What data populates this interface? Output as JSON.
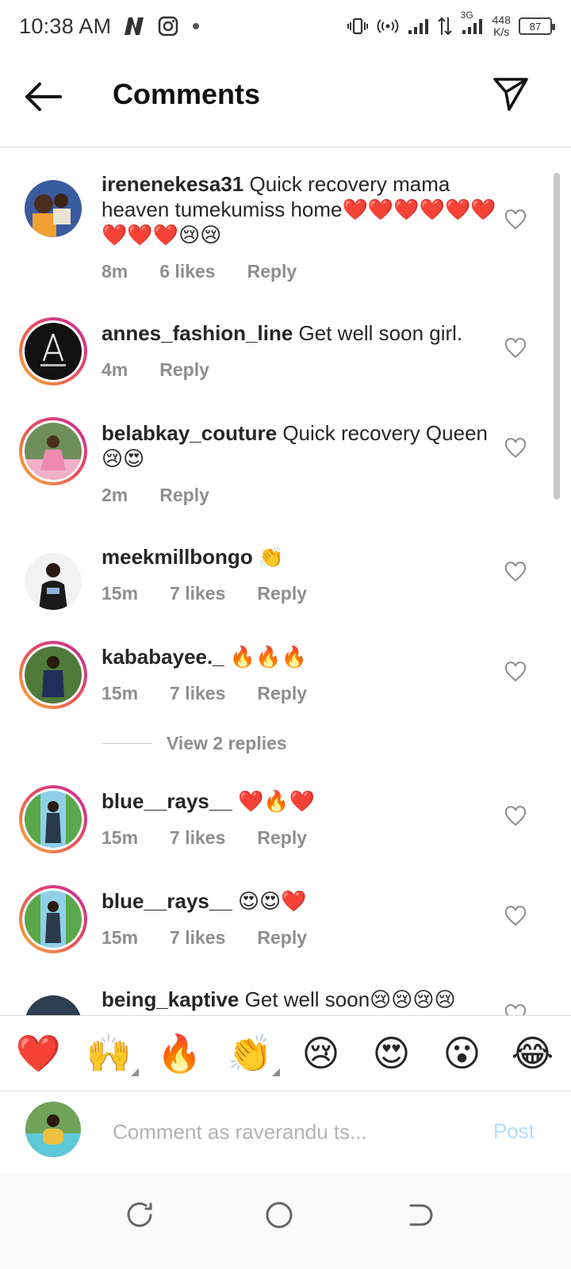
{
  "status_bar": {
    "time": "10:38 AM",
    "net_type": "3G",
    "net_speed_value": "448",
    "net_speed_unit": "K/s",
    "battery": "87",
    "icons": [
      "netflix-n-icon",
      "instagram-icon",
      "dot-icon",
      "vibrate-icon",
      "hotspot-icon",
      "signal-icon",
      "data-arrows-icon",
      "signal-3g-icon",
      "battery-icon"
    ]
  },
  "header": {
    "title": "Comments"
  },
  "comments": [
    {
      "username": "irenenekesa31",
      "text": " Quick recovery mama heaven tumekumiss home❤️❤️❤️❤️❤️❤️❤️❤️❤️😢😢",
      "time": "8m",
      "likes": "6 likes",
      "reply": "Reply",
      "ring": false
    },
    {
      "username": "annes_fashion_line",
      "text": " Get well soon girl.",
      "time": "4m",
      "likes": "",
      "reply": "Reply",
      "ring": true
    },
    {
      "username": "belabkay_couture",
      "text": " Quick recovery Queen 😢😍",
      "time": "2m",
      "likes": "",
      "reply": "Reply",
      "ring": true
    },
    {
      "username": "meekmillbongo",
      "text": " 👏",
      "time": "15m",
      "likes": "7 likes",
      "reply": "Reply",
      "ring": false
    },
    {
      "username": "kababayee._",
      "text": " 🔥🔥🔥",
      "time": "15m",
      "likes": "7 likes",
      "reply": "Reply",
      "ring": true
    },
    {
      "username": "blue__rays__",
      "text": " ❤️🔥❤️",
      "time": "15m",
      "likes": "7 likes",
      "reply": "Reply",
      "ring": true
    },
    {
      "username": "blue__rays__",
      "text": " 😍😍❤️",
      "time": "15m",
      "likes": "7 likes",
      "reply": "Reply",
      "ring": true
    },
    {
      "username": "being_kaptive",
      "text": " Get well soon😢😢😢😢",
      "time": "",
      "likes": "",
      "reply": "",
      "ring": false
    }
  ],
  "view_replies": "View 2 replies",
  "emoji_bar": [
    "❤️",
    "🙌",
    "🔥",
    "👏",
    "😢",
    "😍",
    "😮",
    "😂"
  ],
  "composer": {
    "placeholder": "Comment as raverandu ts...",
    "post_label": "Post"
  },
  "colors": {
    "ring_gradient": [
      "#f9b233",
      "#e8505b",
      "#c32aa3"
    ],
    "muted_text": "#8e8e8e",
    "post_disabled": "#b3dbff"
  }
}
